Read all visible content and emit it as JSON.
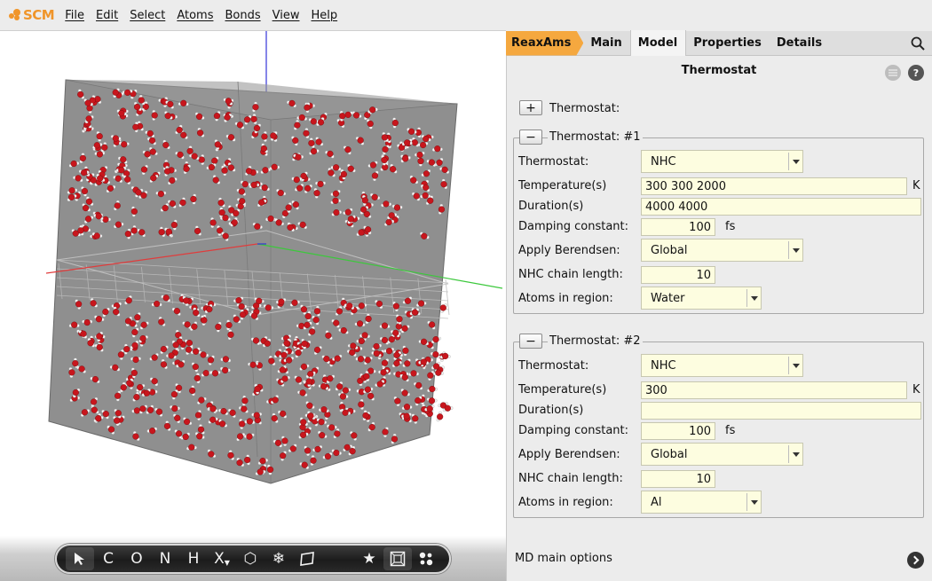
{
  "app": {
    "logo_text": "SCM",
    "logo_color": "#f0952a"
  },
  "menu": [
    "File",
    "Edit",
    "Select",
    "Atoms",
    "Bonds",
    "View",
    "Help"
  ],
  "toolbar": {
    "buttons": [
      {
        "name": "select-arrow-icon",
        "glyph": ""
      },
      {
        "name": "carbon-button",
        "glyph": "C"
      },
      {
        "name": "oxygen-button",
        "glyph": "O"
      },
      {
        "name": "nitrogen-button",
        "glyph": "N"
      },
      {
        "name": "hydrogen-button",
        "glyph": "H"
      },
      {
        "name": "other-element-button",
        "glyph": "X"
      },
      {
        "name": "ring-icon",
        "glyph": "⬡"
      },
      {
        "name": "snowflake-icon",
        "glyph": "❄"
      },
      {
        "name": "plane-icon",
        "glyph": ""
      },
      {
        "name": "favorites-star-icon",
        "glyph": "★"
      },
      {
        "name": "periodic-box-icon",
        "glyph": ""
      },
      {
        "name": "molecule-dots-icon",
        "glyph": ""
      }
    ]
  },
  "tabs": {
    "app": "ReaxAms",
    "items": [
      "Main",
      "Model",
      "Properties",
      "Details"
    ],
    "active": "Model",
    "app_color": "#f5a83f"
  },
  "panel": {
    "title": "Thermostat",
    "help_glyph": "?",
    "add_label": "Thermostat:",
    "add_glyph": "+",
    "remove_glyph": "−",
    "thermostats": [
      {
        "header": "Thermostat: #1",
        "labels": {
          "thermostat": "Thermostat:",
          "temperature": "Temperature(s)",
          "duration": "Duration(s)",
          "damping": "Damping constant:",
          "berendsen": "Apply Berendsen:",
          "nhc": "NHC chain length:",
          "region": "Atoms in region:"
        },
        "thermostat": "NHC",
        "temperature": "300 300 2000",
        "temperature_unit": "K",
        "duration": "4000 4000",
        "damping": "100",
        "damping_unit": "fs",
        "berendsen": "Global",
        "nhc": "10",
        "region": "Water"
      },
      {
        "header": "Thermostat: #2",
        "labels": {
          "thermostat": "Thermostat:",
          "temperature": "Temperature(s)",
          "duration": "Duration(s)",
          "damping": "Damping constant:",
          "berendsen": "Apply Berendsen:",
          "nhc": "NHC chain length:",
          "region": "Atoms in region:"
        },
        "thermostat": "NHC",
        "temperature": "300",
        "temperature_unit": "K",
        "duration": "",
        "damping": "100",
        "damping_unit": "fs",
        "berendsen": "Global",
        "nhc": "10",
        "region": "Al"
      }
    ],
    "footer": "MD main options"
  },
  "colors": {
    "field_bg": "#fdfde0",
    "atom_oxygen": "#c8161d",
    "atom_hydrogen": "#f4f4f4",
    "box_gray": "#8e8e8e",
    "axis_x": "#e03030",
    "axis_y": "#30c030",
    "axis_z": "#3030e0"
  }
}
